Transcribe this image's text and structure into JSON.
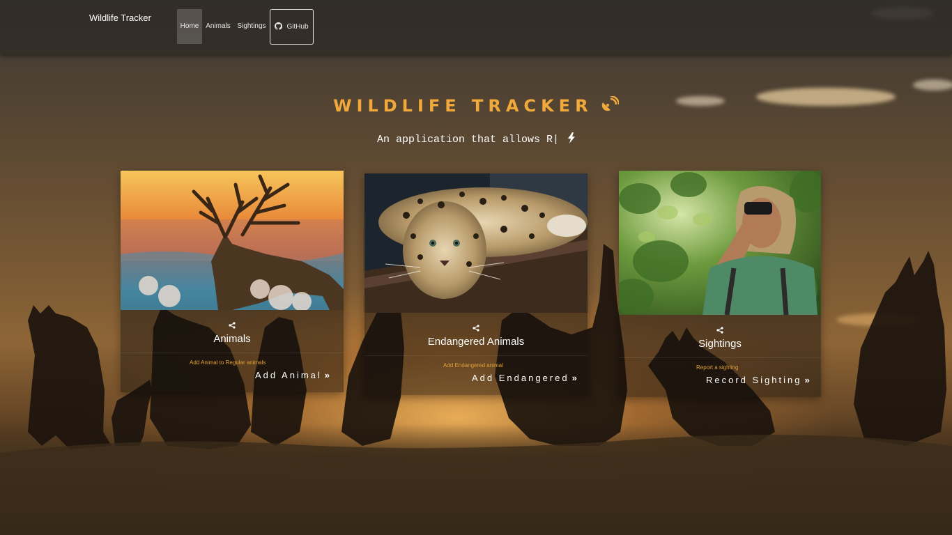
{
  "navbar": {
    "brand": "Wildlife Tracker",
    "items": [
      {
        "label": "Home",
        "active": true
      },
      {
        "label": "Animals"
      },
      {
        "label": "Sightings"
      }
    ],
    "github": {
      "label": "GitHub",
      "icon": "github-icon"
    }
  },
  "hero": {
    "title": "WILDLIFE TRACKER",
    "title_icon": "satellite-dish-icon",
    "subtitle": "An application that allows R|",
    "subtitle_icon": "bolt-icon"
  },
  "cards": [
    {
      "title": "Animals",
      "share_icon": "share-icon",
      "image": "deer-photo",
      "note": "Add Animal to Regular animals",
      "action": "Add Animal",
      "action_icon": "double-chevron-right-icon"
    },
    {
      "title": "Endangered Animals",
      "share_icon": "share-icon",
      "image": "leopard-photo",
      "note": "Add Endangered animal",
      "action": "Add Endangered",
      "action_icon": "double-chevron-right-icon"
    },
    {
      "title": "Sightings",
      "share_icon": "share-icon",
      "image": "birdwatcher-photo",
      "note": "Report a sighting",
      "action": "Record Sighting",
      "action_icon": "double-chevron-right-icon"
    }
  ],
  "colors": {
    "accent": "#f2a93b",
    "note": "#e1a038",
    "nav_bg": "#2d2824"
  }
}
